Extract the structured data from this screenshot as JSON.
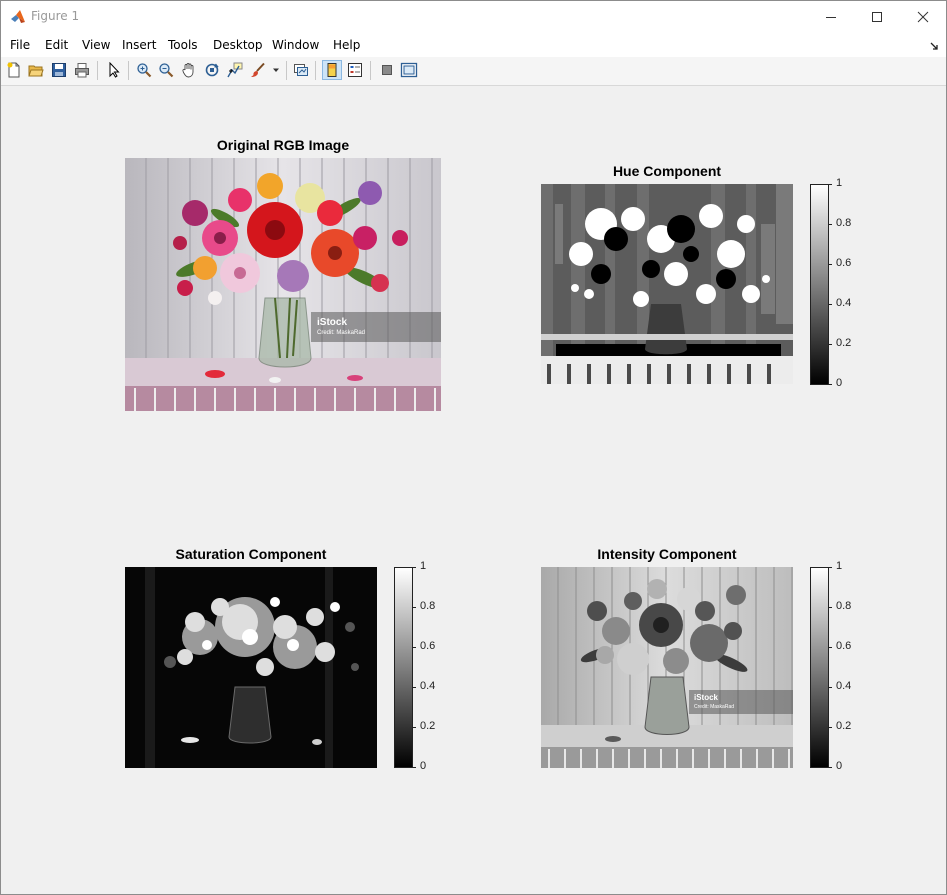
{
  "window": {
    "title": "Figure 1"
  },
  "menu": [
    "File",
    "Edit",
    "View",
    "Insert",
    "Tools",
    "Desktop",
    "Window",
    "Help"
  ],
  "toolbar": {
    "icons": [
      "new-figure-icon",
      "open-file-icon",
      "save-icon",
      "print-icon",
      "select-arrow-icon",
      "zoom-in-icon",
      "zoom-out-icon",
      "pan-hand-icon",
      "rotate-3d-icon",
      "data-cursor-icon",
      "brush-icon",
      "link-plot-icon",
      "insert-colorbar-icon",
      "insert-legend-icon",
      "hide-plot-tools-icon",
      "show-plot-tools-icon"
    ]
  },
  "axes": {
    "rgb": {
      "title": "Original RGB Image",
      "watermark": {
        "brand": "iStock",
        "credit": "Credit: MaskaRad"
      }
    },
    "hue": {
      "title": "Hue Component",
      "colorbar_ticks": [
        "1",
        "0.8",
        "0.6",
        "0.4",
        "0.2",
        "0"
      ]
    },
    "sat": {
      "title": "Saturation Component",
      "colorbar_ticks": [
        "1",
        "0.8",
        "0.6",
        "0.4",
        "0.2",
        "0"
      ]
    },
    "int": {
      "title": "Intensity Component",
      "colorbar_ticks": [
        "1",
        "0.8",
        "0.6",
        "0.4",
        "0.2",
        "0"
      ],
      "watermark": {
        "brand": "iStock",
        "credit": "Credit: MaskaRad"
      }
    }
  },
  "colors": {
    "colormap": "gray",
    "titlebar": "#ffffff",
    "canvas": "#f0f0f0"
  }
}
